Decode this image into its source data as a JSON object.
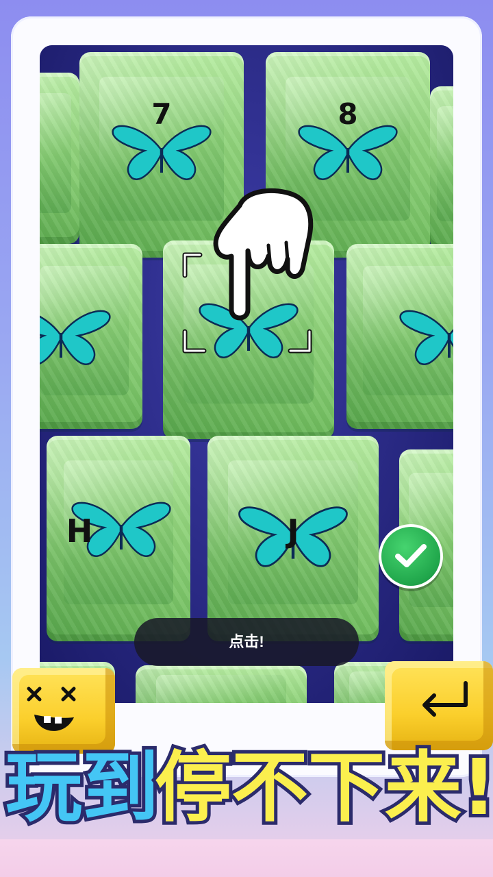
{
  "game": {
    "keys": [
      {
        "id": "key-7",
        "letter": "7"
      },
      {
        "id": "key-8",
        "letter": "8"
      },
      {
        "id": "key-left-mid",
        "letter": ""
      },
      {
        "id": "key-center",
        "letter": ""
      },
      {
        "id": "key-right-mid",
        "letter": ""
      },
      {
        "id": "key-h",
        "letter": "H"
      },
      {
        "id": "key-j",
        "letter": "J"
      }
    ],
    "toast": "点击!",
    "banner": {
      "part1": "玩到",
      "part2": "停不下来!"
    },
    "colors": {
      "butterfly_main": "#1fc7c8",
      "butterfly_outline": "#0b2b55",
      "check_green": "#22a84c",
      "block_yellow": "#fcd434",
      "banner_blue": "#44c6f5",
      "banner_yellow": "#fbef4e"
    },
    "icons": [
      "butterfly-icon",
      "pointing-hand-icon",
      "check-icon",
      "dizzy-face-icon",
      "enter-arrow-icon"
    ]
  }
}
